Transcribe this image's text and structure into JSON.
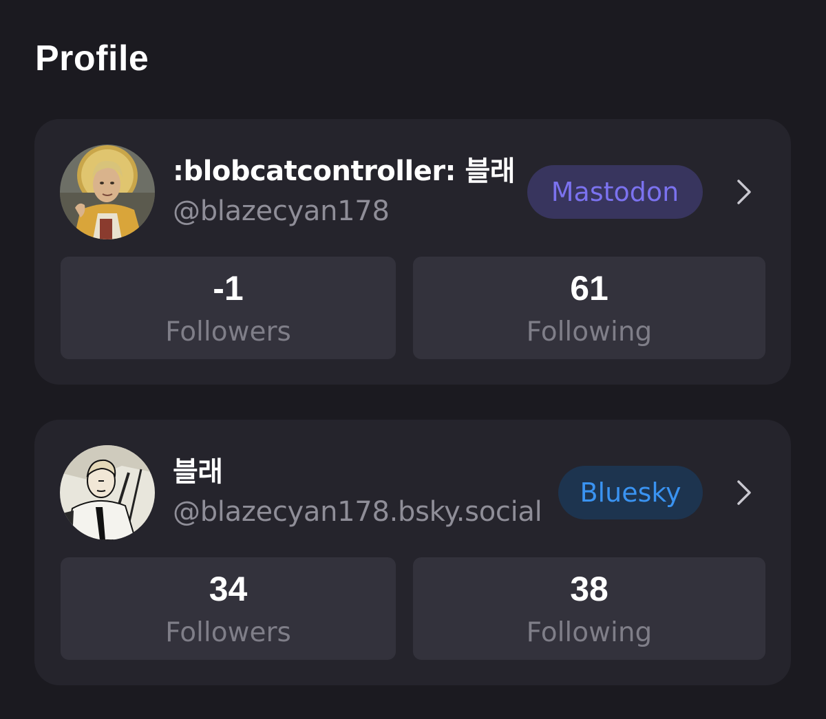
{
  "header": {
    "title": "Profile"
  },
  "accounts": [
    {
      "display_name": ":blobcatcontroller: 블래",
      "handle": "@blazecyan178",
      "platform": "Mastodon",
      "platform_colors": {
        "background": "#38355e",
        "text": "#7b72ef"
      },
      "avatar_icon": "avatar-haloed-man-illustration",
      "followers": {
        "value": "-1",
        "label": "Followers"
      },
      "following": {
        "value": "61",
        "label": "Following"
      }
    },
    {
      "display_name": "블래",
      "handle": "@blazecyan178.bsky.social",
      "platform": "Bluesky",
      "platform_colors": {
        "background": "#1d344f",
        "text": "#3a93f1"
      },
      "avatar_icon": "avatar-comic-man-illustration",
      "followers": {
        "value": "34",
        "label": "Followers"
      },
      "following": {
        "value": "38",
        "label": "Following"
      }
    }
  ],
  "icons": {
    "chevron": "chevron-right-icon"
  }
}
